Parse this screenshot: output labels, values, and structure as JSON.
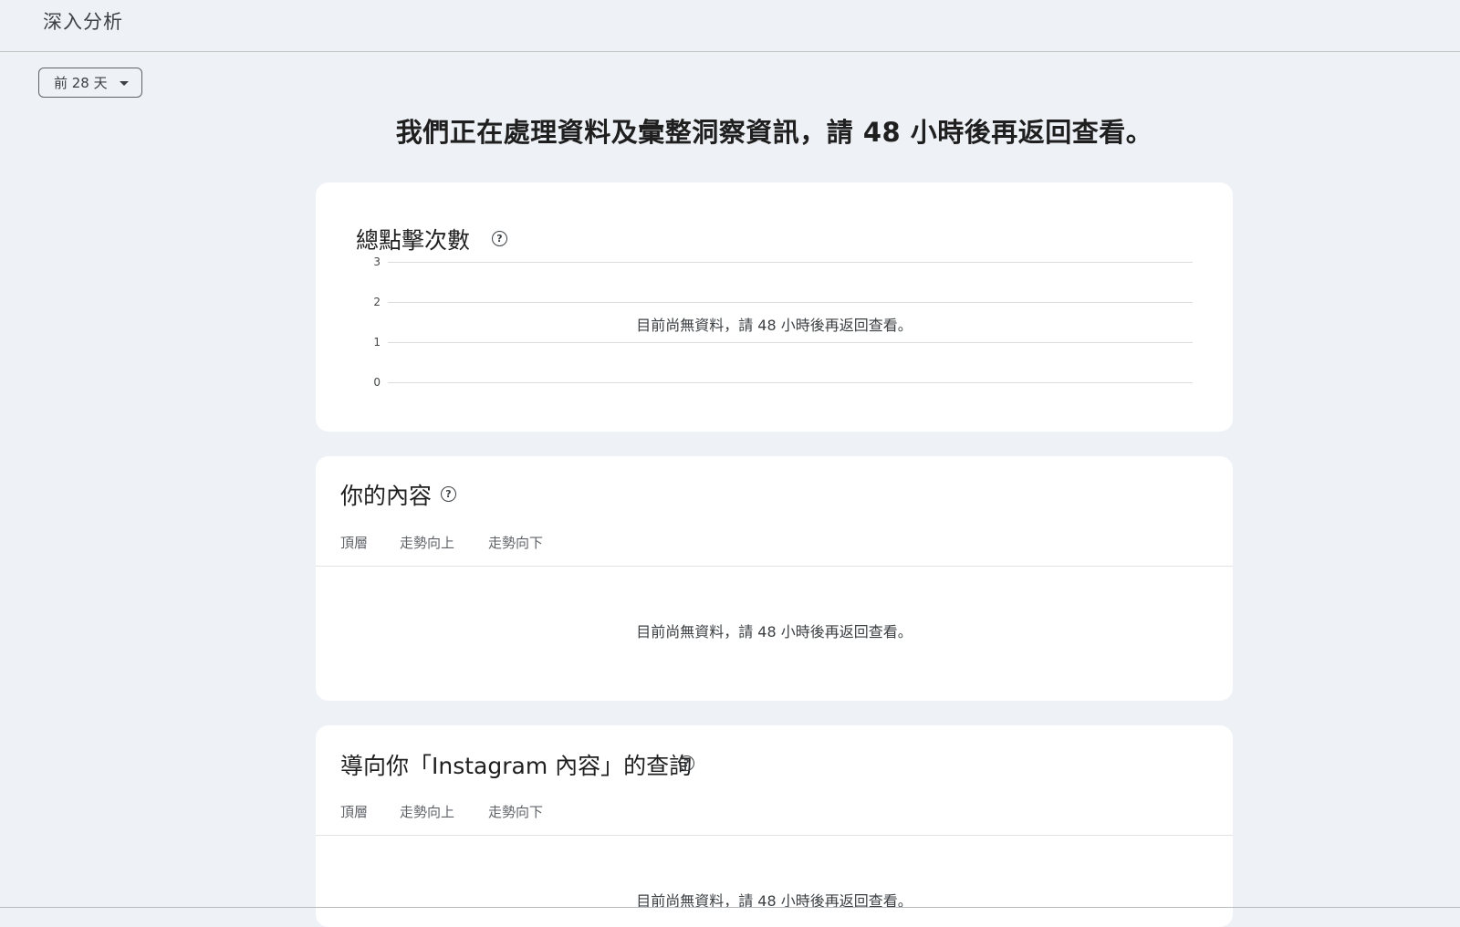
{
  "page": {
    "title": "深入分析",
    "date_filter": "前 28 天",
    "banner": "我們正在處理資料及彙整洞察資訊，請 48 小時後再返回查看。"
  },
  "clicks_card": {
    "title": "總點擊次數",
    "help_icon": "help-circle-icon",
    "empty_message": "目前尚無資料，請 48 小時後再返回查看。",
    "chart_data": {
      "type": "line",
      "title": "",
      "y_ticks": [
        "3",
        "2",
        "1",
        "0"
      ],
      "ylim": [
        0,
        3
      ],
      "grid": true,
      "series": []
    }
  },
  "content_card": {
    "title": "你的內容",
    "help_icon": "help-circle-icon",
    "tabs": [
      "頂層",
      "走勢向上",
      "走勢向下"
    ],
    "empty_message": "目前尚無資料，請 48 小時後再返回查看。"
  },
  "queries_card": {
    "title": "導向你「Instagram 內容」的查詢",
    "help_icon": "help-circle-icon",
    "tabs": [
      "頂層",
      "走勢向上",
      "走勢向下"
    ],
    "empty_message": "目前尚無資料，請 48 小時後再返回查看。"
  }
}
